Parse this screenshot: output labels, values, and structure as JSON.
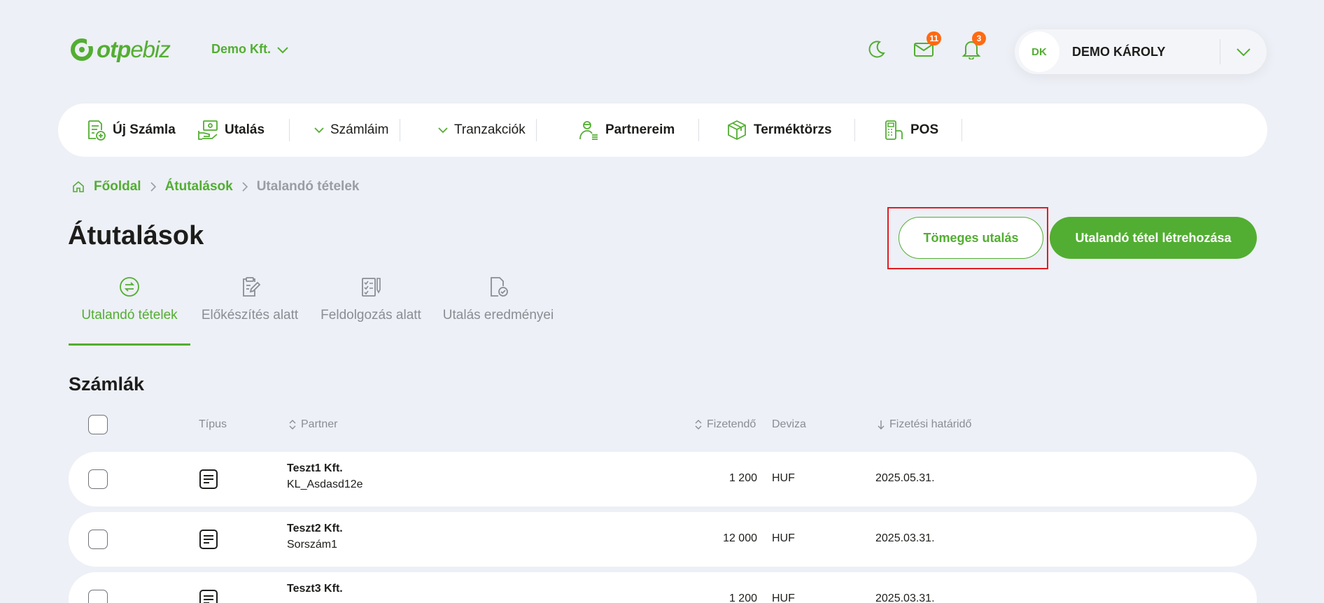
{
  "header": {
    "logo_text_bold": "otp",
    "logo_text_light": "ebiz",
    "company": "Demo Kft.",
    "mail_badge": "11",
    "bell_badge": "3",
    "user_initials": "DK",
    "user_name": "DEMO KÁROLY"
  },
  "nav": {
    "new_invoice": "Új Számla",
    "transfer": "Utalás",
    "accounts": "Számláim",
    "transactions": "Tranzakciók",
    "partners": "Partnereim",
    "products": "Terméktörzs",
    "pos": "POS"
  },
  "breadcrumb": {
    "home": "Főoldal",
    "transfers": "Átutalások",
    "current": "Utalandó tételek"
  },
  "page": {
    "title": "Átutalások",
    "bulk_button": "Tömeges utalás",
    "create_button": "Utalandó tétel létrehozása"
  },
  "tabs": [
    {
      "label": "Utalandó tételek",
      "icon": "transfer-arrows-icon",
      "active": true
    },
    {
      "label": "Előkészítés alatt",
      "icon": "clipboard-edit-icon",
      "active": false
    },
    {
      "label": "Feldolgozás alatt",
      "icon": "checklist-icon",
      "active": false
    },
    {
      "label": "Utalás eredményei",
      "icon": "document-check-icon",
      "active": false
    }
  ],
  "invoices": {
    "title": "Számlák",
    "columns": {
      "type": "Típus",
      "partner": "Partner",
      "payable": "Fizetendő",
      "currency": "Deviza",
      "deadline": "Fizetési határidő"
    },
    "rows": [
      {
        "partner": "Teszt1 Kft.",
        "ref": "KL_Asdasd12e",
        "amount": "1 200",
        "currency": "HUF",
        "deadline": "2025.05.31."
      },
      {
        "partner": "Teszt2 Kft.",
        "ref": "Sorszám1",
        "amount": "12 000",
        "currency": "HUF",
        "deadline": "2025.03.31."
      },
      {
        "partner": "Teszt3 Kft.",
        "ref": "",
        "amount": "1 200",
        "currency": "HUF",
        "deadline": "2025.03.31."
      }
    ]
  },
  "colors": {
    "brand_green": "#52ae32",
    "badge_orange": "#ff6a13",
    "background": "#edf0f6",
    "highlight_red": "#e21c24"
  }
}
